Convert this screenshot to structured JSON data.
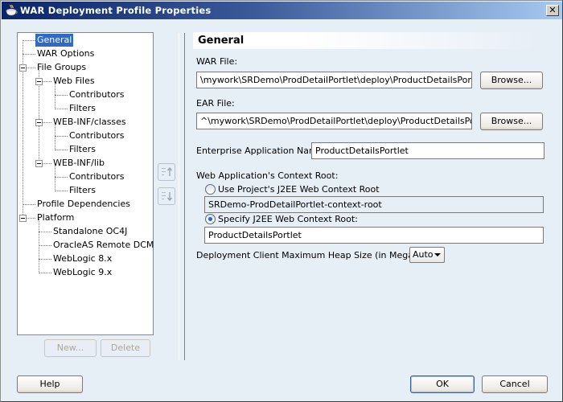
{
  "window": {
    "title": "WAR Deployment Profile Properties",
    "app_icon": "coffee-cup-icon",
    "close_icon": "close-icon",
    "close_label": "✕"
  },
  "tree": {
    "nodes": [
      {
        "label": "General",
        "level": 0,
        "selected": true
      },
      {
        "label": "WAR Options",
        "level": 0
      },
      {
        "label": "File Groups",
        "level": 0,
        "expanded": true
      },
      {
        "label": "Web Files",
        "level": 1,
        "expanded": true
      },
      {
        "label": "Contributors",
        "level": 2
      },
      {
        "label": "Filters",
        "level": 2
      },
      {
        "label": "WEB-INF/classes",
        "level": 1,
        "expanded": true
      },
      {
        "label": "Contributors",
        "level": 2
      },
      {
        "label": "Filters",
        "level": 2
      },
      {
        "label": "WEB-INF/lib",
        "level": 1,
        "expanded": true
      },
      {
        "label": "Contributors",
        "level": 2
      },
      {
        "label": "Filters",
        "level": 2
      },
      {
        "label": "Profile Dependencies",
        "level": 0
      },
      {
        "label": "Platform",
        "level": 0,
        "expanded": true
      },
      {
        "label": "Standalone OC4J",
        "level": 1
      },
      {
        "label": "OracleAS Remote DCM",
        "level": 1
      },
      {
        "label": "WebLogic 8.x",
        "level": 1
      },
      {
        "label": "WebLogic 9.x",
        "level": 1
      }
    ],
    "new_button": "New...",
    "delete_button": "Delete",
    "move_up_icon": "move-up-icon",
    "move_down_icon": "move-down-icon"
  },
  "general": {
    "header": "General",
    "war_file_label": "WAR File:",
    "war_file_value": "\\mywork\\SRDemo\\ProdDetailPortlet\\deploy\\ProductDetailsPortlet.war",
    "browse_label": "Browse...",
    "ear_file_label": "EAR File:",
    "ear_file_value": "^\\mywork\\SRDemo\\ProdDetailPortlet\\deploy\\ProductDetailsPortlet.ear",
    "enterprise_app_label": "Enterprise Application Name:",
    "enterprise_app_value": "ProductDetailsPortlet",
    "context_root_label": "Web Application's Context Root:",
    "use_project_label": "Use Project's J2EE Web Context Root",
    "use_project_selected": false,
    "project_context_root_value": "SRDemo-ProdDetailPortlet-context-root",
    "specify_label": "Specify J2EE Web Context Root:",
    "specify_selected": true,
    "specify_value": "ProductDetailsPortlet",
    "heap_label": "Deployment Client Maximum Heap Size (in Megabytes):",
    "heap_value": "Auto"
  },
  "footer": {
    "help_button": "Help",
    "ok_button": "OK",
    "cancel_button": "Cancel"
  }
}
